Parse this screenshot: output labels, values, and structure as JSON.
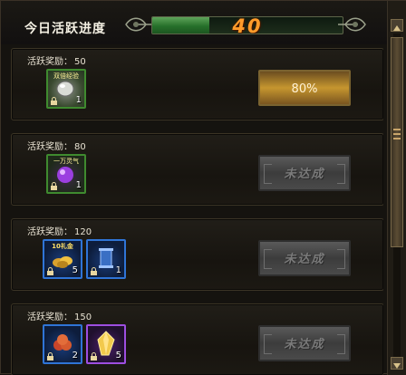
{
  "header": {
    "title": "今日活跃进度",
    "progress_value": "40",
    "progress_fraction": 0.3
  },
  "reward_label": "活跃奖励：",
  "cards": [
    {
      "points": "50",
      "items": [
        {
          "name": "double-exp-item",
          "tag": "双倍经验",
          "count": "1",
          "frame": "green"
        }
      ],
      "button": {
        "state": "active",
        "text": "80%"
      }
    },
    {
      "points": "80",
      "items": [
        {
          "name": "purple-orb-item",
          "tag": "一万灵气",
          "count": "1",
          "frame": "green"
        }
      ],
      "button": {
        "state": "disabled",
        "text": "未达成"
      }
    },
    {
      "points": "120",
      "items": [
        {
          "name": "gold-coins-item",
          "tag": "10礼金",
          "count": "5",
          "frame": "blue"
        },
        {
          "name": "scroll-item",
          "tag": "",
          "count": "1",
          "frame": "blue"
        }
      ],
      "button": {
        "state": "disabled",
        "text": "未达成"
      }
    },
    {
      "points": "150",
      "items": [
        {
          "name": "red-gems-item",
          "tag": "",
          "count": "2",
          "frame": "blue"
        },
        {
          "name": "gold-crystal-item",
          "tag": "",
          "count": "5",
          "frame": "purple"
        }
      ],
      "button": {
        "state": "disabled",
        "text": "未达成"
      }
    }
  ],
  "colors": {
    "progress_text": "#ff9b2a",
    "green_frame": "#3f8a2f",
    "blue_frame": "#2f74d6",
    "purple_frame": "#9d4ee0"
  }
}
